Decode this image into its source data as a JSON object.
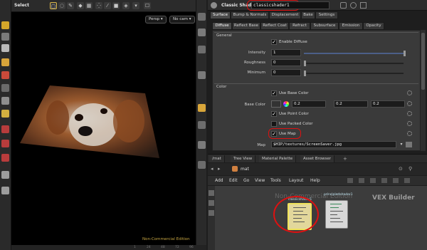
{
  "viewport": {
    "title": "Select",
    "camera_dropdowns": [
      "Persp",
      "No cam"
    ],
    "watermark": "Non-Commercial Edition",
    "ruler_ticks": [
      "1",
      "24",
      "48",
      "72",
      "96",
      "120",
      "144",
      "168",
      "192",
      "216",
      "240"
    ]
  },
  "parm_panel": {
    "node_type": "Classic Shader",
    "node_name": "classicshader1",
    "top_tabs": [
      "Surface",
      "Bump & Normals",
      "Displacement",
      "Bake",
      "Settings"
    ],
    "sub_tabs": [
      "Diffuse",
      "Reflect Base",
      "Reflect Coat",
      "Refract",
      "Subsurface",
      "Emission",
      "Opacity"
    ],
    "general": {
      "section": "General",
      "enable_diffuse": "Enable Diffuse",
      "intensity_label": "Intensity",
      "intensity_value": "1",
      "roughness_label": "Roughness",
      "roughness_value": "0",
      "minimum_label": "Minimum",
      "minimum_value": "0"
    },
    "color": {
      "section": "Color",
      "use_base_color": "Use Base Color",
      "base_color_label": "Base Color",
      "base_color_values": [
        "0.2",
        "0.2",
        "0.2"
      ],
      "use_point_color": "Use Point Color",
      "use_packed_color": "Use Packed Color",
      "use_map": "Use Map",
      "map_label": "Map",
      "map_value": "$HIP/textures/ScreenSaver.jpg"
    }
  },
  "network": {
    "tabs": [
      "/mat",
      "Tree View",
      "Material Palette",
      "Asset Browser"
    ],
    "path": "mat",
    "menus": [
      "Add",
      "Edit",
      "Go",
      "View",
      "Tools",
      "Layout",
      "Help"
    ],
    "watermark": "Non-Commercial Edition",
    "context_label": "VEX Builder",
    "node1_label": "classicshader1",
    "node2_label": "principledshader1"
  },
  "colors": {
    "highlight": "#dd1111",
    "node_selected": "#f0e35a",
    "watermark": "#c6a542"
  }
}
